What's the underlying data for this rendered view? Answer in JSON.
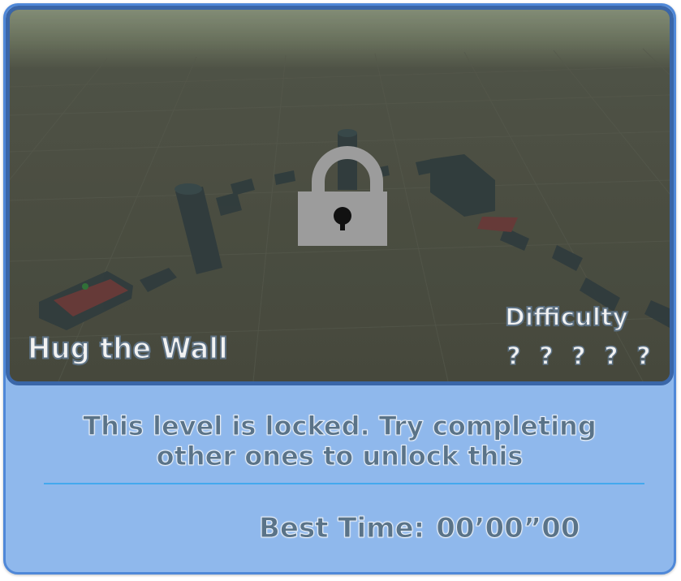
{
  "level": {
    "title": "Hug the Wall",
    "locked": true
  },
  "difficulty": {
    "label": "Difficulty",
    "marks": [
      "?",
      "?",
      "?",
      "?",
      "?"
    ]
  },
  "lock_message": {
    "line1": "This level is locked. Try completing",
    "line2": "other ones to unlock this"
  },
  "best_time": {
    "label": "Best Time:",
    "value": "00’00”00"
  },
  "icons": {
    "lock": "padlock-icon"
  },
  "colors": {
    "card_bg": "#8fb8ec",
    "card_border": "#4f88d8",
    "preview_border": "#3a66a8",
    "divider": "#43a8ee",
    "text_dark": "#5a7388",
    "text_light": "#f2f2f2"
  }
}
